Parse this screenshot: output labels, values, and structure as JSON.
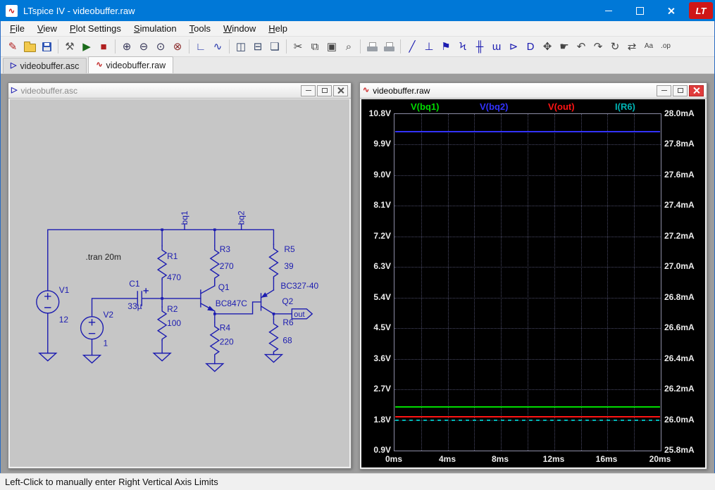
{
  "window": {
    "title": "LTspice IV - videobuffer.raw",
    "app_icon_glyph": "∿",
    "logo_text": "LT"
  },
  "menu": {
    "items": [
      {
        "label": "File"
      },
      {
        "label": "View"
      },
      {
        "label": "Plot Settings"
      },
      {
        "label": "Simulation"
      },
      {
        "label": "Tools"
      },
      {
        "label": "Window"
      },
      {
        "label": "Help"
      }
    ]
  },
  "toolbar": {
    "groups": [
      [
        {
          "name": "new-schematic",
          "glyph": "✎",
          "color": "#b22222"
        },
        {
          "name": "open",
          "css": "ic-folder"
        },
        {
          "name": "save",
          "css": "ic-floppy"
        }
      ],
      [
        {
          "name": "control-panel",
          "glyph": "⚒",
          "color": "#555555"
        },
        {
          "name": "run",
          "glyph": "▶",
          "color": "#1a6b1a"
        },
        {
          "name": "halt",
          "glyph": "■",
          "color": "#b02020"
        }
      ],
      [
        {
          "name": "zoom-area",
          "glyph": "⊕",
          "color": "#333355"
        },
        {
          "name": "zoom-back",
          "glyph": "⊖",
          "color": "#333355"
        },
        {
          "name": "zoom-full-extents",
          "glyph": "⊙",
          "color": "#333355"
        },
        {
          "name": "zoom-reset",
          "glyph": "⊗",
          "color": "#8a2a2a"
        }
      ],
      [
        {
          "name": "autorange-y-axis",
          "glyph": "∟",
          "color": "#2233aa"
        },
        {
          "name": "plot-settings",
          "glyph": "∿",
          "color": "#2233aa"
        }
      ],
      [
        {
          "name": "tile-vertical",
          "glyph": "◫",
          "color": "#334466"
        },
        {
          "name": "tile-horizontal",
          "glyph": "⊟",
          "color": "#334466"
        },
        {
          "name": "cascade-windows",
          "glyph": "❏",
          "color": "#334466"
        }
      ],
      [
        {
          "name": "cut",
          "glyph": "✂",
          "color": "#444444"
        },
        {
          "name": "copy",
          "glyph": "⧉",
          "color": "#444444"
        },
        {
          "name": "paste",
          "glyph": "▣",
          "color": "#444444"
        },
        {
          "name": "find",
          "glyph": "⌕",
          "color": "#444444"
        }
      ],
      [
        {
          "name": "print-preview",
          "css": "ic-printer"
        },
        {
          "name": "print",
          "css": "ic-printer"
        }
      ],
      [
        {
          "name": "wire",
          "glyph": "╱",
          "color": "#1c1cb0"
        },
        {
          "name": "ground",
          "glyph": "⊥",
          "color": "#1c1cb0"
        },
        {
          "name": "label-net",
          "glyph": "⚑",
          "color": "#1c1cb0"
        },
        {
          "name": "resistor",
          "glyph": "Ϟ",
          "color": "#1c1cb0"
        },
        {
          "name": "capacitor",
          "glyph": "╫",
          "color": "#1c1cb0"
        },
        {
          "name": "inductor",
          "glyph": "ɯ",
          "color": "#1c1cb0"
        },
        {
          "name": "diode",
          "glyph": "⊳",
          "color": "#1c1cb0"
        },
        {
          "name": "component",
          "glyph": "D",
          "color": "#1c1cb0"
        },
        {
          "name": "move",
          "glyph": "✥",
          "color": "#444444"
        },
        {
          "name": "drag",
          "glyph": "☛",
          "color": "#444444"
        },
        {
          "name": "undo",
          "glyph": "↶",
          "color": "#444444"
        },
        {
          "name": "redo",
          "glyph": "↷",
          "color": "#444444"
        },
        {
          "name": "rotate",
          "glyph": "↻",
          "color": "#444444"
        },
        {
          "name": "mirror",
          "glyph": "⇄",
          "color": "#444444"
        },
        {
          "name": "text",
          "glyph": "Aa",
          "color": "#444444",
          "small": true
        },
        {
          "name": "spice-directive",
          "glyph": ".op",
          "color": "#444444",
          "small": true
        }
      ]
    ]
  },
  "tabs": [
    {
      "label": "videobuffer.asc",
      "icon": "schematic",
      "icon_glyph": "▷",
      "icon_color": "#1c1cb0",
      "active": false
    },
    {
      "label": "videobuffer.raw",
      "icon": "waveform",
      "icon_glyph": "∿",
      "icon_color": "#c02020",
      "active": true
    }
  ],
  "schematic_window": {
    "title": "videobuffer.asc",
    "icon_glyph": "▷",
    "directive": ".tran 20m",
    "parts": {
      "V1": {
        "ref": "V1",
        "value": "12"
      },
      "V2": {
        "ref": "V2",
        "value": "1"
      },
      "C1": {
        "ref": "C1",
        "value": "33µ"
      },
      "R1": {
        "ref": "R1",
        "value": "470"
      },
      "R2": {
        "ref": "R2",
        "value": "100"
      },
      "R3": {
        "ref": "R3",
        "value": "270"
      },
      "R4": {
        "ref": "R4",
        "value": "220"
      },
      "R5": {
        "ref": "R5",
        "value": "39"
      },
      "R6": {
        "ref": "R6",
        "value": "68"
      },
      "Q1": {
        "ref": "Q1",
        "value": "BC847C"
      },
      "Q2": {
        "ref": "Q2",
        "value": "BC327-40"
      }
    },
    "nets": {
      "bq1": "bq1",
      "bq2": "bq2",
      "out": "out"
    }
  },
  "plot_window": {
    "title": "videobuffer.raw",
    "icon_glyph": "∿"
  },
  "chart_data": {
    "type": "line",
    "title": "videobuffer.raw",
    "background": "#000000",
    "grid": true,
    "legend_position": "top",
    "x_axis": {
      "unit": "ms",
      "range": [
        0,
        20
      ],
      "minor_ms": 2,
      "ticks": [
        "0ms",
        "4ms",
        "8ms",
        "12ms",
        "16ms",
        "20ms"
      ]
    },
    "y_left": {
      "unit": "V",
      "min": 0.9,
      "max": 10.8,
      "step": 0.9,
      "ticks": [
        "10.8V",
        "9.9V",
        "9.0V",
        "8.1V",
        "7.2V",
        "6.3V",
        "5.4V",
        "4.5V",
        "3.6V",
        "2.7V",
        "1.8V",
        "0.9V"
      ]
    },
    "y_right": {
      "unit": "mA",
      "min": 25.8,
      "max": 28.0,
      "step": 0.2,
      "ticks": [
        "28.0mA",
        "27.8mA",
        "27.6mA",
        "27.4mA",
        "27.2mA",
        "27.0mA",
        "26.8mA",
        "26.6mA",
        "26.4mA",
        "26.2mA",
        "26.0mA",
        "25.8mA"
      ]
    },
    "series": [
      {
        "name": "V(bq1)",
        "color": "#00dc00",
        "axis": "left",
        "shape": "constant",
        "value": 2.18,
        "unit": "V"
      },
      {
        "name": "V(bq2)",
        "color": "#3232ff",
        "axis": "left",
        "shape": "constant",
        "value": 10.28,
        "unit": "V"
      },
      {
        "name": "V(out)",
        "color": "#ff1414",
        "axis": "left",
        "shape": "constant",
        "value": 1.89,
        "unit": "V"
      },
      {
        "name": "I(R6)",
        "color": "#00b4b4",
        "axis": "right",
        "shape": "constant",
        "value": 26.0,
        "unit": "mA",
        "render": "dashed"
      }
    ]
  },
  "status": {
    "text": "Left-Click to manually enter Right Vertical Axis Limits"
  }
}
